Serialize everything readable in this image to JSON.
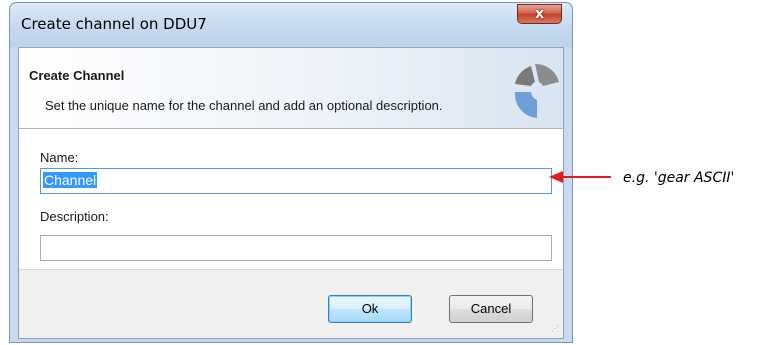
{
  "window": {
    "title": "Create channel on DDU7",
    "close_glyph": "x"
  },
  "header": {
    "title": "Create Channel",
    "subtitle": "Set the unique name for the channel and add an optional description.",
    "logo_icon": "channel-logo-icon"
  },
  "form": {
    "name_label": "Name:",
    "name_value": "Channel",
    "description_label": "Description:",
    "description_value": ""
  },
  "buttons": {
    "ok": "Ok",
    "cancel": "Cancel"
  },
  "annotation": {
    "text": "e.g. 'gear ASCII'",
    "arrow_color": "#e11b22"
  },
  "colors": {
    "close_button": "#c2402a",
    "selection": "#3399ff",
    "focus_border": "#5b9bd5"
  }
}
